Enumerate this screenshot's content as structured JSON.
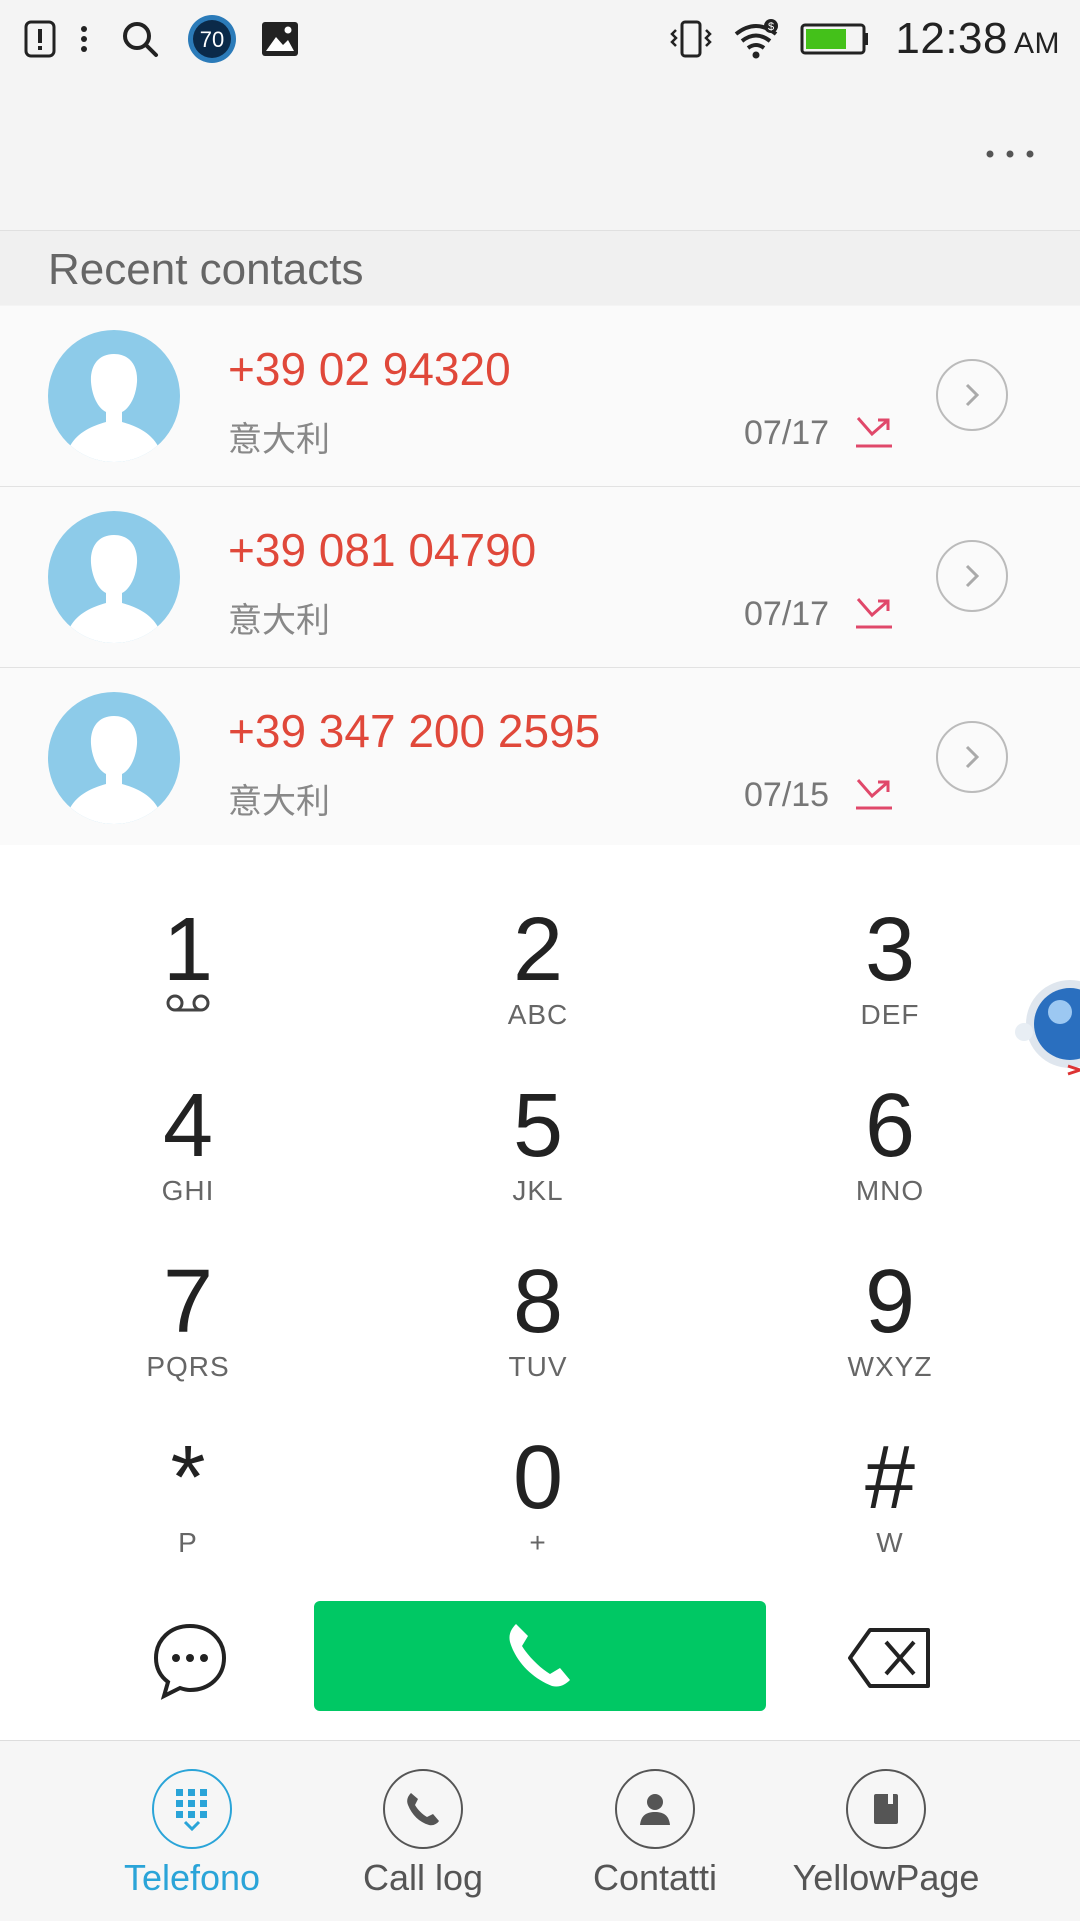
{
  "status_bar": {
    "notification_badge": "70",
    "time": "12:38",
    "ampm": "AM",
    "icons": [
      "alert-icon",
      "more-vert-icon",
      "search-icon",
      "badge-70-icon",
      "image-icon",
      "vibrate-icon",
      "wifi-icon",
      "battery-icon"
    ],
    "battery_color": "#44c11a"
  },
  "section": {
    "title": "Recent contacts"
  },
  "recent_contacts": [
    {
      "number": "+39 02 94320",
      "location": "意大利",
      "date": "07/17"
    },
    {
      "number": "+39 081 04790",
      "location": "意大利",
      "date": "07/17"
    },
    {
      "number": "+39 347 200 2595",
      "location": "意大利",
      "date": "07/15"
    }
  ],
  "dialpad": [
    {
      "digit": "1",
      "letters": ""
    },
    {
      "digit": "2",
      "letters": "ABC"
    },
    {
      "digit": "3",
      "letters": "DEF"
    },
    {
      "digit": "4",
      "letters": "GHI"
    },
    {
      "digit": "5",
      "letters": "JKL"
    },
    {
      "digit": "6",
      "letters": "MNO"
    },
    {
      "digit": "7",
      "letters": "PQRS"
    },
    {
      "digit": "8",
      "letters": "TUV"
    },
    {
      "digit": "9",
      "letters": "WXYZ"
    },
    {
      "digit": "*",
      "letters": "P"
    },
    {
      "digit": "0",
      "letters": "+"
    },
    {
      "digit": "#",
      "letters": "W"
    }
  ],
  "nav": [
    {
      "label": "Telefono",
      "icon": "dialpad-icon",
      "active": true
    },
    {
      "label": "Call log",
      "icon": "phone-icon",
      "active": false
    },
    {
      "label": "Contatti",
      "icon": "person-icon",
      "active": false
    },
    {
      "label": "YellowPage",
      "icon": "book-icon",
      "active": false
    }
  ],
  "colors": {
    "accent": "#2aa4d8",
    "call_green": "#00c864",
    "missed_red": "#e0483a",
    "avatar_blue": "#8dcbe9"
  }
}
